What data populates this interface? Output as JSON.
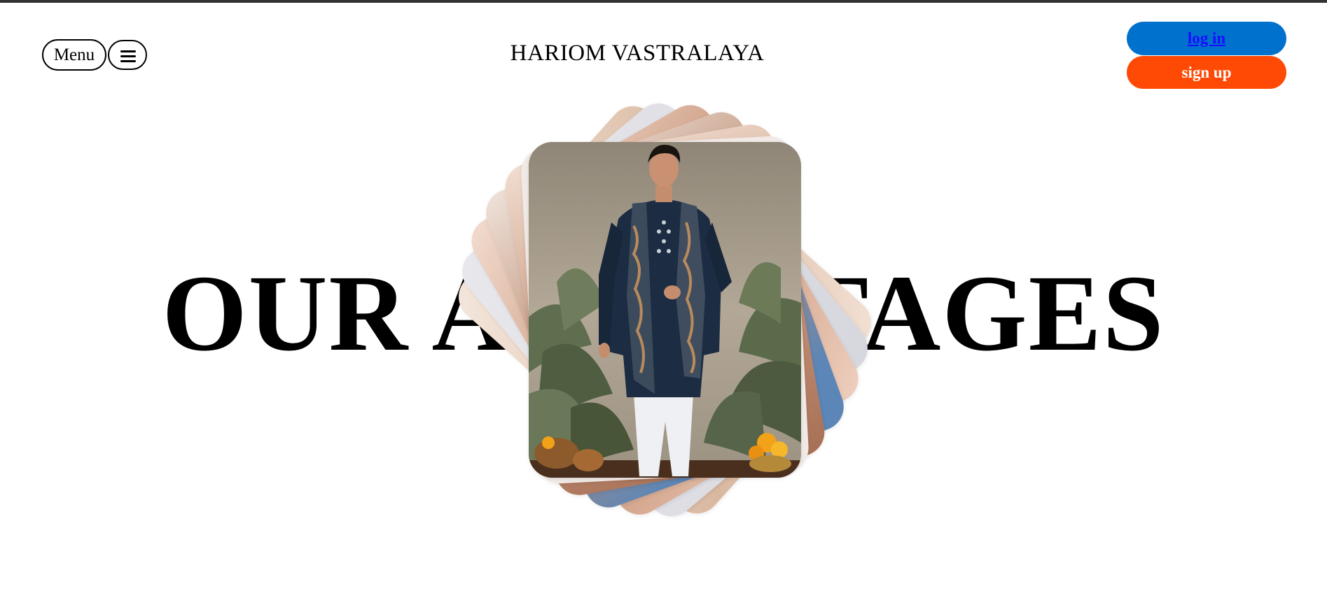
{
  "header": {
    "menu_label": "Menu",
    "hamburger_icon": "hamburger-menu-icon",
    "brand_name": "HARIOM VASTRALAYA",
    "login_label": "log in",
    "signup_label": "sign up"
  },
  "hero": {
    "heading_left": "OUR A",
    "heading_right": "TAGES",
    "featured_image": "man in navy embroidered kurta with patterned scarf and white trousers"
  },
  "colors": {
    "login_bg": "#0171ce",
    "login_text": "#1a0dff",
    "signup_bg": "#ff4a05",
    "signup_text": "#ffffff",
    "top_border": "#333333"
  }
}
